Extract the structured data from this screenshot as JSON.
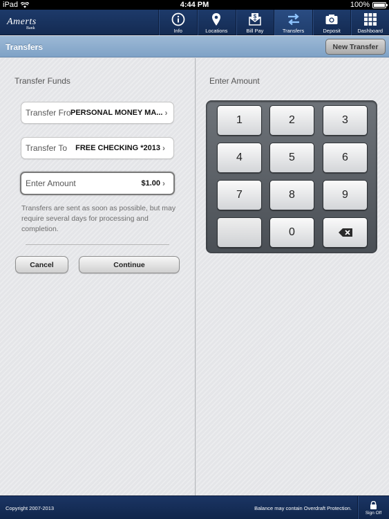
{
  "statusbar": {
    "device": "iPad",
    "time": "4:44 PM",
    "battery": "100%"
  },
  "brand": {
    "name": "Amerts",
    "sub": "Bank"
  },
  "nav": [
    {
      "label": "Info",
      "icon": "info-icon"
    },
    {
      "label": "Locations",
      "icon": "location-pin-icon"
    },
    {
      "label": "Bill Pay",
      "icon": "bill-pay-icon"
    },
    {
      "label": "Transfers",
      "icon": "transfer-arrows-icon",
      "active": true
    },
    {
      "label": "Deposit",
      "icon": "camera-icon"
    },
    {
      "label": "Dashboard",
      "icon": "grid-icon"
    }
  ],
  "titlebar": {
    "title": "Transfers",
    "new_transfer": "New Transfer"
  },
  "left": {
    "title": "Transfer Funds",
    "from": {
      "label": "Transfer From",
      "value": "PERSONAL MONEY MA..."
    },
    "to": {
      "label": "Transfer To",
      "value": "FREE CHECKING *2013"
    },
    "amount": {
      "label": "Enter Amount",
      "value": "$1.00"
    },
    "note": "Transfers are sent as soon as possible, but may require several days for processing and completion.",
    "cancel": "Cancel",
    "continue": "Continue"
  },
  "right": {
    "title": "Enter Amount",
    "keys": [
      "1",
      "2",
      "3",
      "4",
      "5",
      "6",
      "7",
      "8",
      "9",
      "",
      "0",
      "backspace"
    ]
  },
  "footer": {
    "copyright": "Copyright 2007-2013",
    "notice": "Balance may contain Overdraft Protection.",
    "signoff": "Sign Off"
  },
  "colors": {
    "nav": "#1d3a6a",
    "titlebar": "#8fb0d0",
    "footer": "#142b52"
  }
}
